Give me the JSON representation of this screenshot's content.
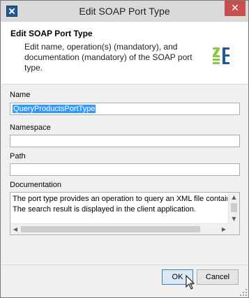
{
  "window": {
    "title": "Edit SOAP Port Type",
    "close_glyph": "✕"
  },
  "header": {
    "title": "Edit SOAP Port Type",
    "description": "Edit name, operation(s) (mandatory), and documentation (mandatory) of the SOAP port type.",
    "logo_icon": "soap-port-type-icon"
  },
  "form": {
    "name_label": "Name",
    "name_value": "QueryProductsPortType",
    "namespace_label": "Namespace",
    "namespace_value": "",
    "path_label": "Path",
    "path_value": "",
    "documentation_label": "Documentation",
    "documentation_lines": [
      "The port type provides an operation to query an XML file contain",
      "The search result is displayed in the client application."
    ]
  },
  "buttons": {
    "ok": "OK",
    "cancel": "Cancel"
  },
  "colors": {
    "selection": "#3399ff",
    "close": "#c7504f",
    "logo_green": "#8dc63f",
    "logo_blue": "#1f5a96"
  }
}
